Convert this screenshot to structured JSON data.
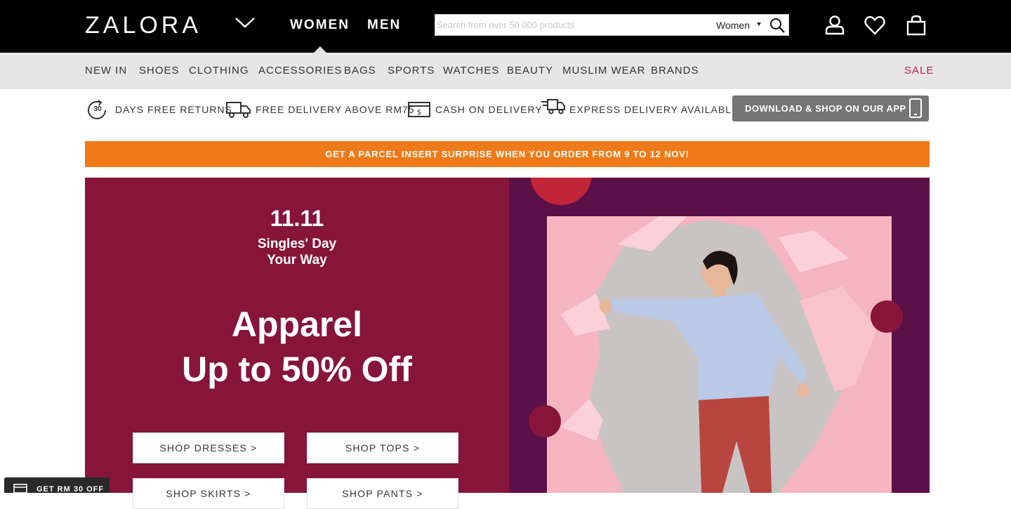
{
  "header": {
    "logo": "ZALORA",
    "gender_tabs": [
      "WOMEN",
      "MEN"
    ],
    "search": {
      "placeholder": "Search from over 50 000 products",
      "category": "Women"
    },
    "icons": [
      "account-icon",
      "heart-icon",
      "shopping-bag-icon"
    ]
  },
  "nav": {
    "categories": [
      "NEW IN",
      "SHOES",
      "CLOTHING",
      "ACCESSORIES",
      "BAGS",
      "SPORTS",
      "WATCHES",
      "BEAUTY",
      "MUSLIM WEAR",
      "BRANDS"
    ],
    "sale": "SALE"
  },
  "usp": {
    "returns_badge": "30",
    "items": [
      "DAYS FREE RETURNS",
      "FREE DELIVERY ABOVE RM75",
      "CASH ON DELIVERY",
      "EXPRESS DELIVERY AVAILABLE"
    ],
    "app_button": "DOWNLOAD & SHOP ON OUR APP"
  },
  "promo_bar": "GET A PARCEL INSERT SURPRISE WHEN YOU ORDER FROM 9 TO 12 NOV!",
  "hero": {
    "date": "11.11",
    "tagline": [
      "Singles' Day",
      "Your Way"
    ],
    "headline": [
      "Apparel",
      "Up to 50% Off"
    ],
    "buttons": [
      "SHOP DRESSES >",
      "SHOP TOPS >",
      "SHOP SKIRTS >",
      "SHOP PANTS >"
    ]
  },
  "voucher": "GET RM 30 OFF",
  "colors": {
    "header_bg": "#000000",
    "nav_bg": "#e6e6e6",
    "sale": "#c2185b",
    "promo": "#ef7a1a",
    "hero_left": "#861539",
    "hero_right": "#5c1048",
    "photo_bg": "#f4b5c0"
  }
}
